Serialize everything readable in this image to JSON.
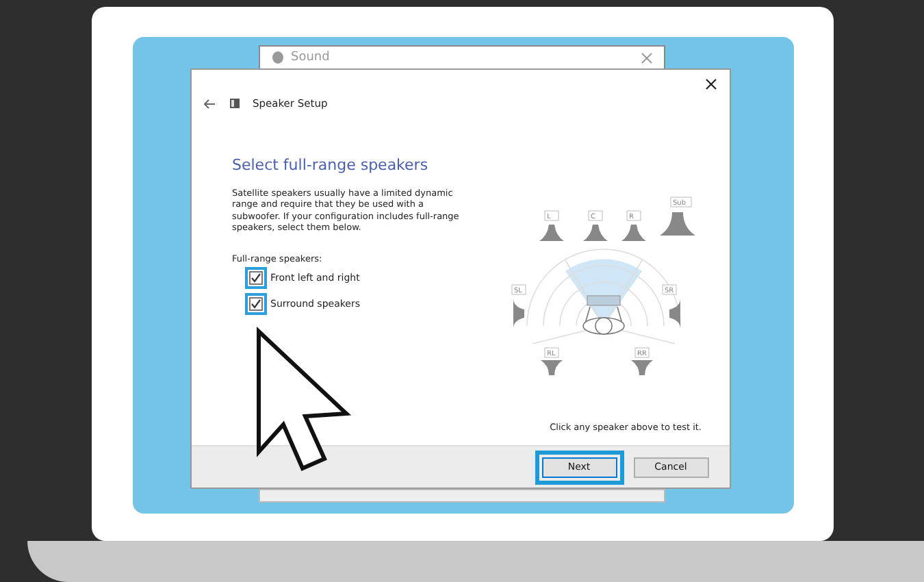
{
  "background_window": {
    "title": "Sound"
  },
  "dialog": {
    "title": "Speaker Setup",
    "heading": "Select full-range speakers",
    "description": "Satellite speakers usually have a limited dynamic range and require that they be used with a subwoofer.  If your configuration includes full-range speakers, select them below.",
    "options_label": "Full-range speakers:",
    "options": [
      {
        "label": "Front left and right",
        "checked": true,
        "highlighted": true
      },
      {
        "label": "Surround speakers",
        "checked": true,
        "highlighted": true
      }
    ],
    "speakers": [
      {
        "label": "L",
        "kind": "front"
      },
      {
        "label": "C",
        "kind": "front"
      },
      {
        "label": "R",
        "kind": "front"
      },
      {
        "label": "Sub",
        "kind": "sub"
      },
      {
        "label": "SL",
        "kind": "left"
      },
      {
        "label": "SR",
        "kind": "right"
      },
      {
        "label": "RL",
        "kind": "rear"
      },
      {
        "label": "RR",
        "kind": "rear"
      }
    ],
    "hint": "Click any speaker above to test it.",
    "buttons": [
      {
        "label": "Next",
        "highlighted": true
      },
      {
        "label": "Cancel",
        "highlighted": false
      }
    ]
  }
}
